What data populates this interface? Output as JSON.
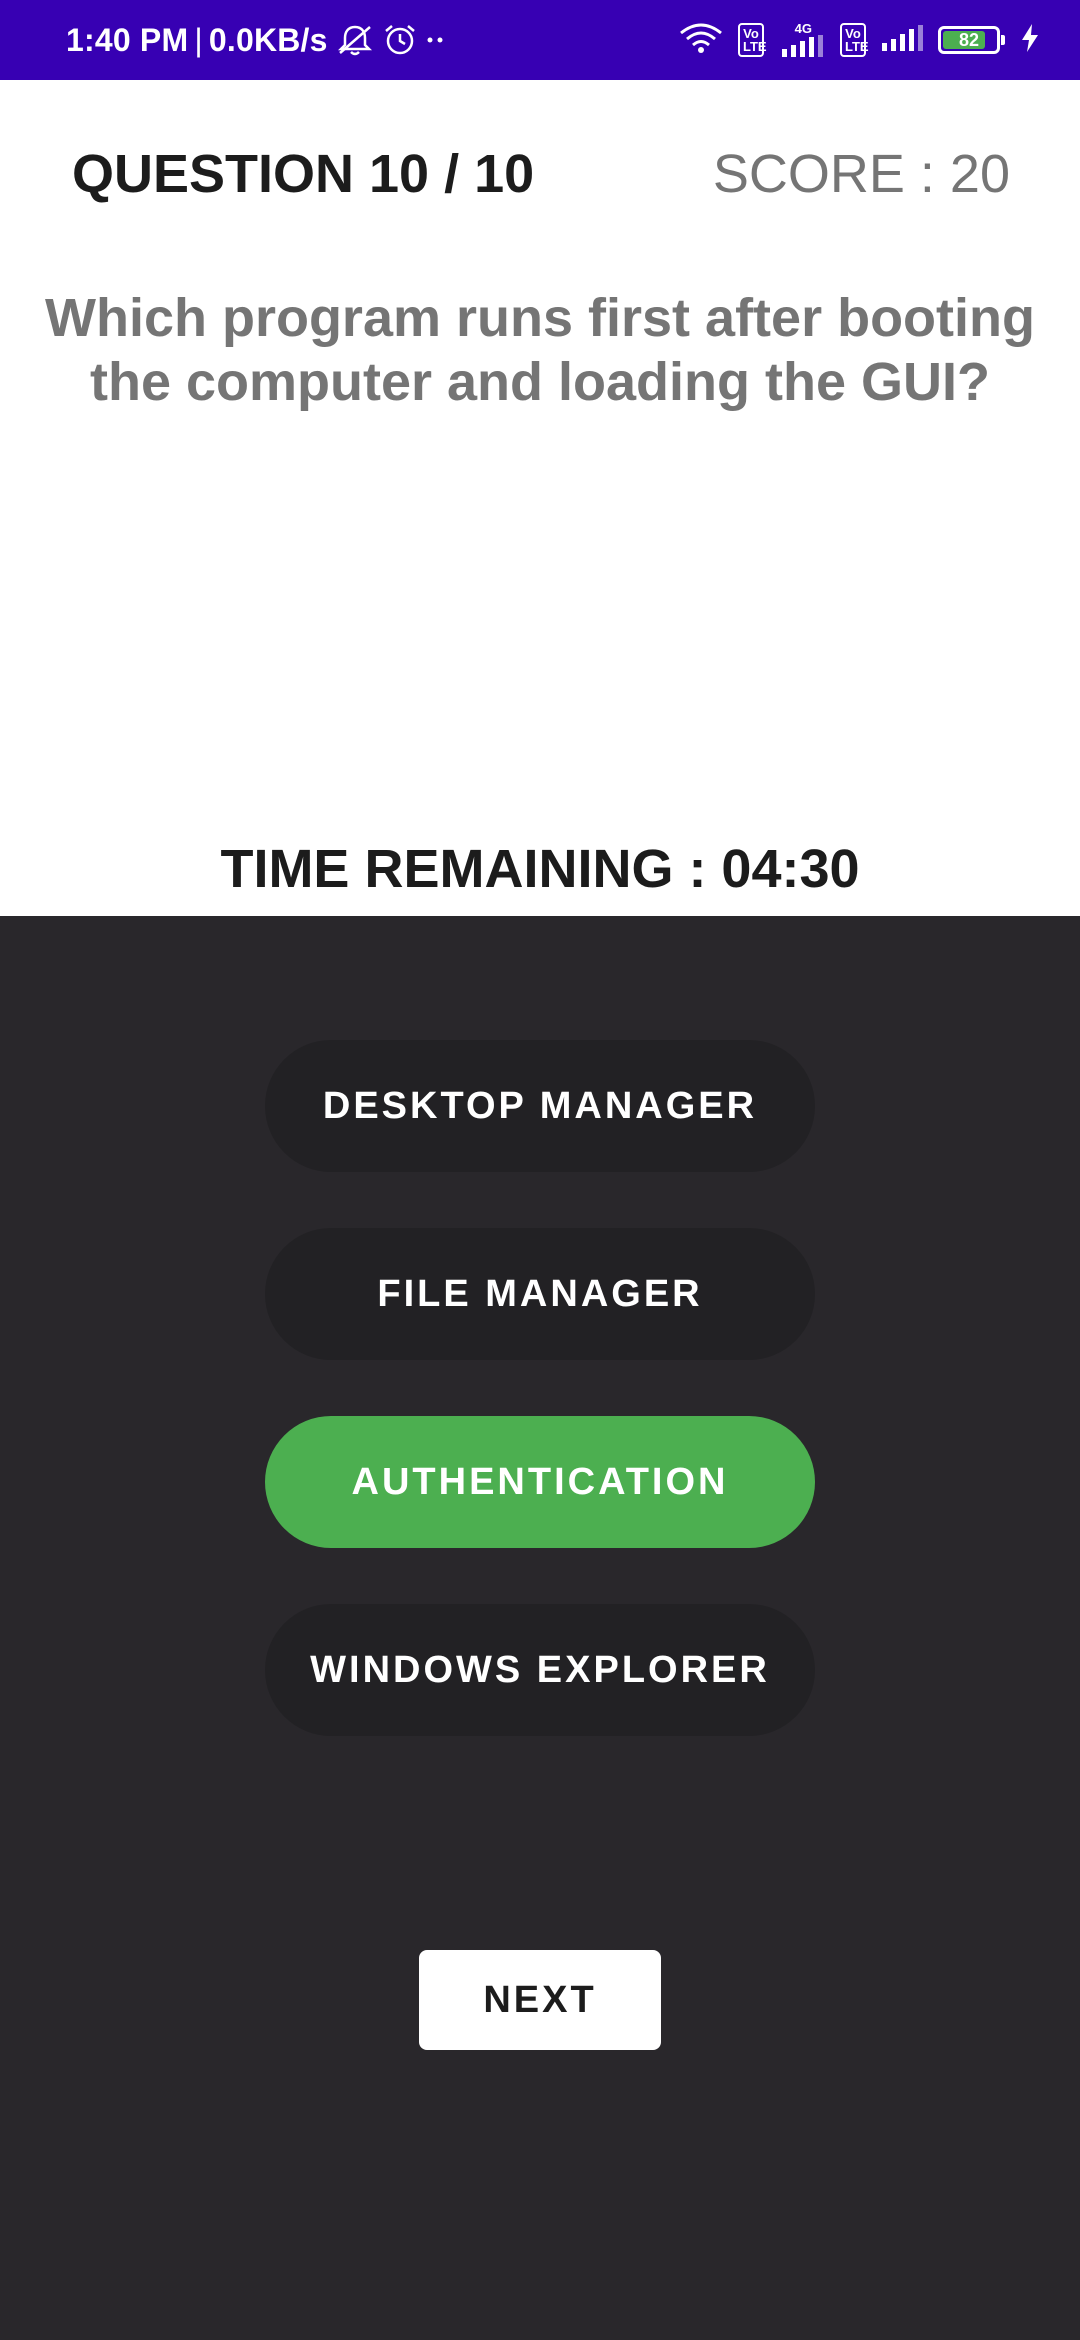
{
  "status_bar": {
    "time": "1:40 PM",
    "separator": "|",
    "network_speed": "0.0KB/s",
    "icons": [
      "mute-icon",
      "alarm-icon",
      "more-dots-icon",
      "wifi-icon",
      "volte-icon",
      "signal-icon",
      "battery-icon",
      "charging-icon"
    ],
    "volte_label": "Vo LTE",
    "network_type": "4G",
    "battery_level": "82",
    "bar_color": "#3700b3"
  },
  "quiz": {
    "question_counter": "QUESTION 10 / 10",
    "score": "SCORE : 20",
    "question": "Which program runs first after booting the computer and loading the GUI?",
    "time_remaining": "TIME REMAINING : 04:30"
  },
  "options": [
    {
      "label": "DESKTOP MANAGER",
      "state": "default"
    },
    {
      "label": "FILE MANAGER",
      "state": "default"
    },
    {
      "label": "AUTHENTICATION",
      "state": "correct"
    },
    {
      "label": "WINDOWS EXPLORER",
      "state": "default"
    }
  ],
  "next_button": {
    "label": "NEXT"
  },
  "colors": {
    "panel_background": "#29272b",
    "option_background": "#222124",
    "correct_option": "#4caf50",
    "question_text": "#757575"
  }
}
